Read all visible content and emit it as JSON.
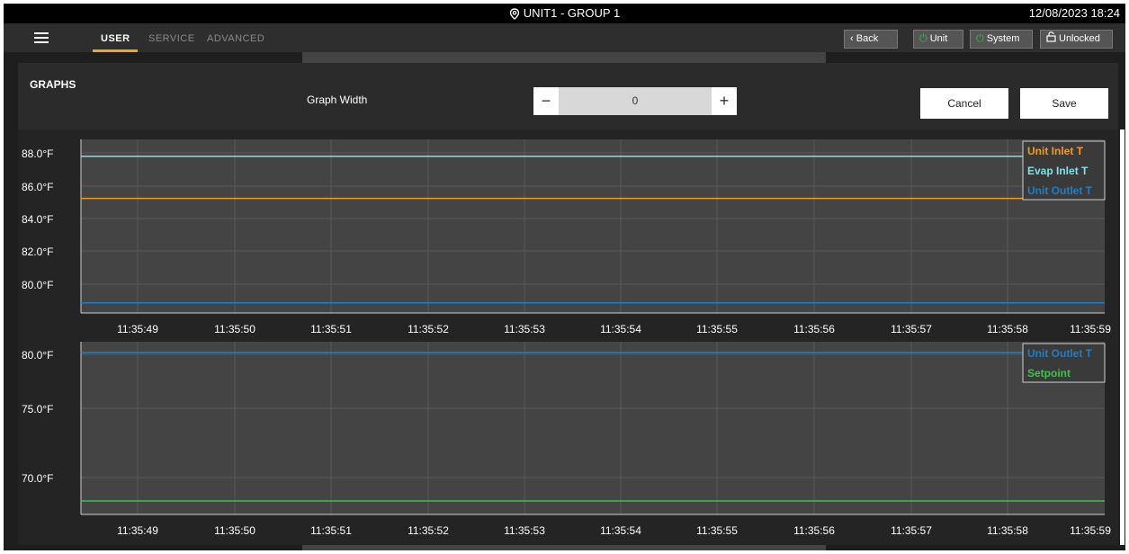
{
  "window": {
    "title": "UNIT1 - GROUP 1",
    "datetime": "12/08/2023 18:24"
  },
  "nav": {
    "tabs": [
      "USER",
      "SERVICE",
      "ADVANCED"
    ],
    "active_tab": "USER",
    "buttons": {
      "back": "Back",
      "unit": "Unit",
      "system": "System",
      "unlocked": "Unlocked"
    }
  },
  "graphs": {
    "title": "GRAPHS",
    "width_label": "Graph Width",
    "width_value": "0",
    "minus": "−",
    "plus": "+",
    "cancel": "Cancel",
    "save": "Save"
  },
  "colors": {
    "accent": "#f2a51e",
    "power_green": "#33c04b",
    "orange": "#f39a1e",
    "cyan": "#7fe0e6",
    "blue": "#1e7fc8",
    "green": "#3fc24a"
  },
  "chart_data": [
    {
      "type": "line",
      "x": [
        "11:35:49",
        "11:35:50",
        "11:35:51",
        "11:35:52",
        "11:35:53",
        "11:35:54",
        "11:35:55",
        "11:35:56",
        "11:35:57",
        "11:35:58",
        "11:35:59"
      ],
      "y_ticks": [
        "88.0°F",
        "86.0°F",
        "84.0°F",
        "82.0°F",
        "80.0°F"
      ],
      "ylim": [
        78.3,
        88.6
      ],
      "grid": true,
      "legend": "top-right",
      "series": [
        {
          "name": "Unit Inlet T",
          "color": "#f39a1e",
          "values": [
            85.1,
            85.1,
            85.1,
            85.1,
            85.1,
            85.1,
            85.1,
            85.1,
            85.1,
            85.1,
            85.1
          ]
        },
        {
          "name": "Evap Inlet T",
          "color": "#7fe0e6",
          "values": [
            87.6,
            87.6,
            87.6,
            87.6,
            87.6,
            87.6,
            87.6,
            87.6,
            87.6,
            87.6,
            87.6
          ]
        },
        {
          "name": "Unit Outlet T",
          "color": "#1e7fc8",
          "values": [
            78.9,
            78.9,
            78.9,
            78.9,
            78.9,
            78.9,
            78.9,
            78.9,
            78.9,
            78.9,
            78.9
          ]
        }
      ]
    },
    {
      "type": "line",
      "x": [
        "11:35:49",
        "11:35:50",
        "11:35:51",
        "11:35:52",
        "11:35:53",
        "11:35:54",
        "11:35:55",
        "11:35:56",
        "11:35:57",
        "11:35:58",
        "11:35:59"
      ],
      "y_ticks": [
        "80.0°F",
        "75.0°F",
        "70.0°F"
      ],
      "ylim": [
        67.8,
        80.6
      ],
      "grid": true,
      "legend": "top-right",
      "series": [
        {
          "name": "Unit Outlet T",
          "color": "#1e7fc8",
          "values": [
            79.8,
            79.8,
            79.8,
            79.8,
            79.8,
            79.8,
            79.8,
            79.8,
            79.8,
            79.8,
            79.8
          ]
        },
        {
          "name": "Setpoint",
          "color": "#3fc24a",
          "values": [
            68.8,
            68.8,
            68.8,
            68.8,
            68.8,
            68.8,
            68.8,
            68.8,
            68.8,
            68.8,
            68.8
          ]
        }
      ]
    }
  ]
}
